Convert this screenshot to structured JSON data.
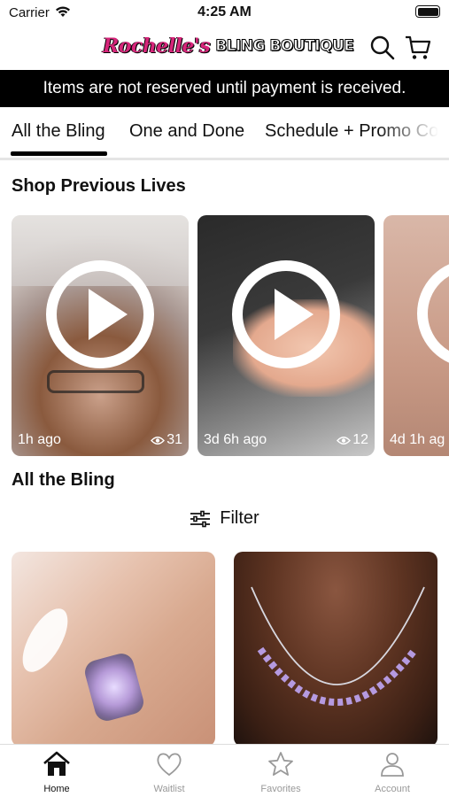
{
  "status_bar": {
    "carrier": "Carrier",
    "time": "4:25 AM"
  },
  "header": {
    "logo_script": "Rochelle's",
    "logo_block": "BLING BOUTIQUE",
    "icons": [
      "search-icon",
      "cart-icon"
    ]
  },
  "notice": "Items are not reserved until payment is received.",
  "tabs": [
    {
      "label": "All the Bling",
      "active": true
    },
    {
      "label": "One and Done",
      "active": false
    },
    {
      "label": "Schedule + Promo Co",
      "active": false
    }
  ],
  "previous_lives": {
    "title": "Shop Previous Lives",
    "videos": [
      {
        "ago": "1h ago",
        "views": "31"
      },
      {
        "ago": "3d 6h ago",
        "views": "12"
      },
      {
        "ago": "4d 1h ag",
        "views": ""
      }
    ]
  },
  "all_bling": {
    "title": "All the Bling",
    "filter_label": "Filter"
  },
  "bottom_nav": [
    {
      "label": "Home",
      "icon": "home-icon",
      "active": true
    },
    {
      "label": "Waitlist",
      "icon": "heart-icon",
      "active": false
    },
    {
      "label": "Favorites",
      "icon": "star-icon",
      "active": false
    },
    {
      "label": "Account",
      "icon": "account-icon",
      "active": false
    }
  ],
  "colors": {
    "brand_pink": "#d6257a",
    "notice_bg": "#000000",
    "inactive_nav": "#999999"
  }
}
